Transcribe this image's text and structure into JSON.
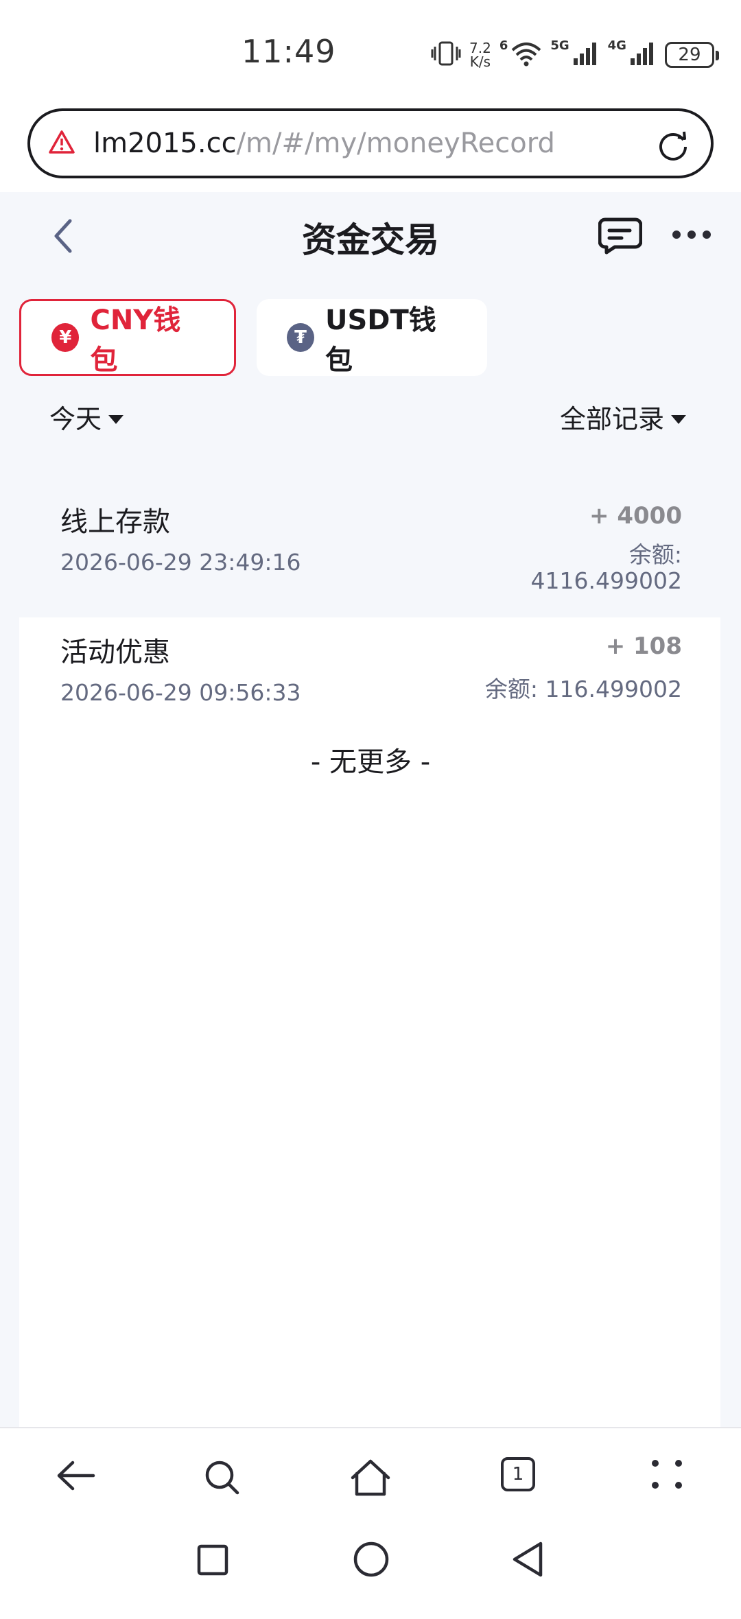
{
  "status": {
    "time": "11:49",
    "speed_value": "7.2",
    "speed_unit": "K/s",
    "wifi_label": "6",
    "sim1_label": "5G",
    "sim2_label": "4G",
    "battery": "29"
  },
  "url_bar": {
    "host": "lm2015.cc",
    "path": "/m/#/my/moneyRecord"
  },
  "header": {
    "title": "资金交易"
  },
  "wallet_tabs": [
    {
      "label": "CNY钱包",
      "coin_symbol": "¥",
      "active": true
    },
    {
      "label": "USDT钱包",
      "coin_symbol": "₮",
      "active": false
    }
  ],
  "filters": {
    "date": "今天",
    "type": "全部记录"
  },
  "records": [
    {
      "title": "线上存款",
      "date": "2026-06-29 23:49:16",
      "amount": "+ 4000",
      "balance_label": "余额:",
      "balance_value": "4116.499002"
    },
    {
      "title": "活动优惠",
      "date": "2026-06-29 09:56:33",
      "amount": "+ 108",
      "balance_label": "余额:",
      "balance_value": "116.499002"
    }
  ],
  "no_more": "- 无更多 -",
  "browser_toolbar": {
    "tab_count": "1"
  },
  "colors": {
    "accent": "#e0243a",
    "background": "#f5f7fb",
    "muted_text": "#646a80"
  }
}
